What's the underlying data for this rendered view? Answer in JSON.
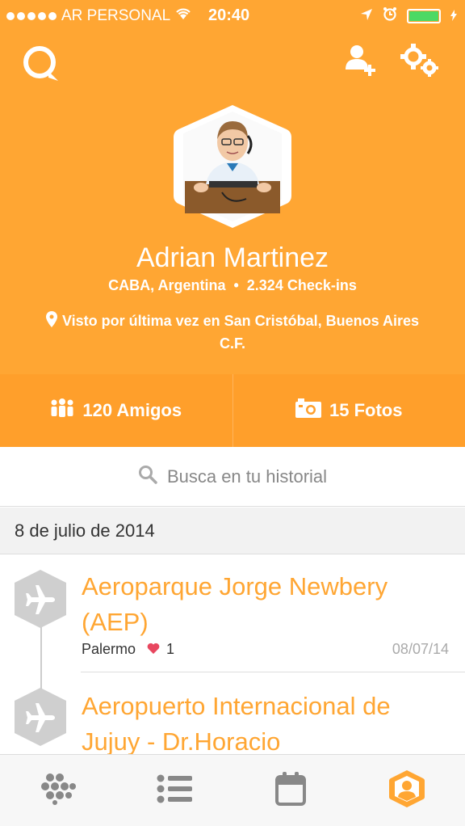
{
  "status_bar": {
    "carrier": "AR PERSONAL",
    "time": "20:40",
    "icons": [
      "signal-dots",
      "wifi-icon",
      "location-arrow-icon",
      "alarm-icon",
      "battery-icon"
    ]
  },
  "toolbar": {
    "search_icon": "search-bubble-icon",
    "add_friend_icon": "add-friend-icon",
    "settings_icon": "gear-icon"
  },
  "profile": {
    "name": "Adrian Martinez",
    "location": "CABA, Argentina",
    "separator": "•",
    "checkins": "2.324 Check-ins",
    "last_seen": "Visto por última vez en San Cristóbal, Buenos Aires C.F."
  },
  "stats": {
    "friends": "120 Amigos",
    "photos": "15 Fotos"
  },
  "search": {
    "placeholder": "Busca en tu historial"
  },
  "history": {
    "date_header": "8 de julio de 2014",
    "items": [
      {
        "title": "Aeroparque Jorge Newbery (AEP)",
        "neighborhood": "Palermo",
        "likes": "1",
        "date": "08/07/14",
        "icon": "airplane-icon"
      },
      {
        "title": "Aeropuerto Internacional de Jujuy - Dr.Horacio",
        "icon": "airplane-icon"
      }
    ]
  },
  "tabbar": {
    "tabs": [
      "explore-icon",
      "list-icon",
      "calendar-icon",
      "profile-icon"
    ],
    "active_tab": "profile-icon"
  },
  "colors": {
    "accent": "#ffa633",
    "stats_bar": "#ff9f2b",
    "battery": "#4cd964"
  }
}
